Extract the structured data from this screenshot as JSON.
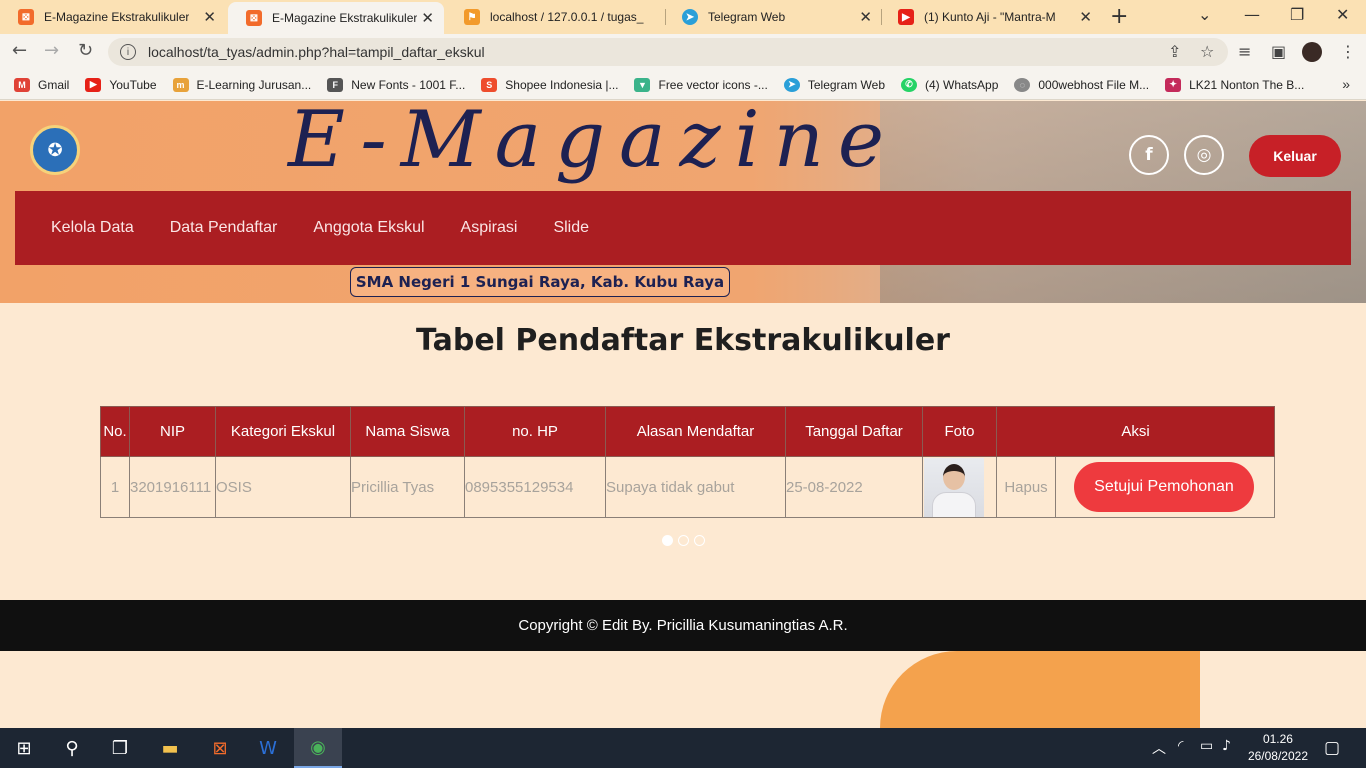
{
  "browser": {
    "tabs": [
      {
        "title": "E-Magazine Ekstrakulikuler",
        "active": false,
        "icon": "xampp-icon",
        "color": "#f26b2b"
      },
      {
        "title": "E-Magazine Ekstrakulikuler",
        "active": true,
        "icon": "xampp-icon",
        "color": "#f26b2b"
      },
      {
        "title": "localhost / 127.0.0.1 / tugas_",
        "active": false,
        "icon": "phpmyadmin-icon",
        "color": "#f29a2b"
      },
      {
        "title": "Telegram Web",
        "active": false,
        "icon": "telegram-icon",
        "color": "#2a9fd8"
      },
      {
        "title": "(1) Kunto Aji - \"Mantra-M",
        "active": false,
        "icon": "youtube-icon",
        "color": "#e62117"
      }
    ],
    "url": "localhost/ta_tyas/admin.php?hal=tampil_daftar_ekskul",
    "bookmarks": [
      {
        "label": "Gmail",
        "icon": "gmail-icon",
        "color": "#e04236"
      },
      {
        "label": "YouTube",
        "icon": "youtube-icon",
        "color": "#e62117"
      },
      {
        "label": "E-Learning Jurusan...",
        "icon": "elearning-icon",
        "color": "#e8a23a"
      },
      {
        "label": "New Fonts - 1001 F...",
        "icon": "fonts-icon",
        "color": "#555555"
      },
      {
        "label": "Shopee Indonesia |...",
        "icon": "shopee-icon",
        "color": "#ee4d2d"
      },
      {
        "label": "Free vector icons -...",
        "icon": "vector-icon",
        "color": "#3bb38a"
      },
      {
        "label": "Telegram Web",
        "icon": "telegram-icon",
        "color": "#2a9fd8"
      },
      {
        "label": "(4) WhatsApp",
        "icon": "whatsapp-icon",
        "color": "#25d366"
      },
      {
        "label": "000webhost File M...",
        "icon": "webhost-icon",
        "color": "#888888"
      },
      {
        "label": "LK21 Nonton The B...",
        "icon": "lk21-icon",
        "color": "#c42a5a"
      }
    ]
  },
  "header": {
    "brand": "E-Magazine",
    "logout": "Keluar",
    "school_badge": "SMA Negeri 1 Sungai Raya, Kab. Kubu Raya",
    "social": [
      {
        "icon": "facebook-icon",
        "glyph": "f"
      },
      {
        "icon": "instagram-icon",
        "glyph": "◎"
      }
    ],
    "nav": [
      "Kelola Data",
      "Data Pendaftar",
      "Anggota Ekskul",
      "Aspirasi",
      "Slide"
    ]
  },
  "main": {
    "title": "Tabel Pendaftar Ekstrakulikuler",
    "columns": [
      "No.",
      "NIP",
      "Kategori Ekskul",
      "Nama Siswa",
      "no. HP",
      "Alasan Mendaftar",
      "Tanggal Daftar",
      "Foto",
      "Aksi"
    ],
    "rows": [
      {
        "no": "1",
        "nip": "3201916111",
        "kategori": "OSIS",
        "nama": "Pricillia Tyas",
        "hp": "0895355129534",
        "alasan": "Supaya tidak gabut",
        "tanggal": "25-08-2022",
        "hapus": "Hapus",
        "setujui": "Setujui Pemohonan"
      }
    ]
  },
  "footer": {
    "text": "Copyright © Edit By. Pricillia Kusumaningtias A.R."
  },
  "taskbar": {
    "time": "01.26",
    "date": "26/08/2022"
  }
}
